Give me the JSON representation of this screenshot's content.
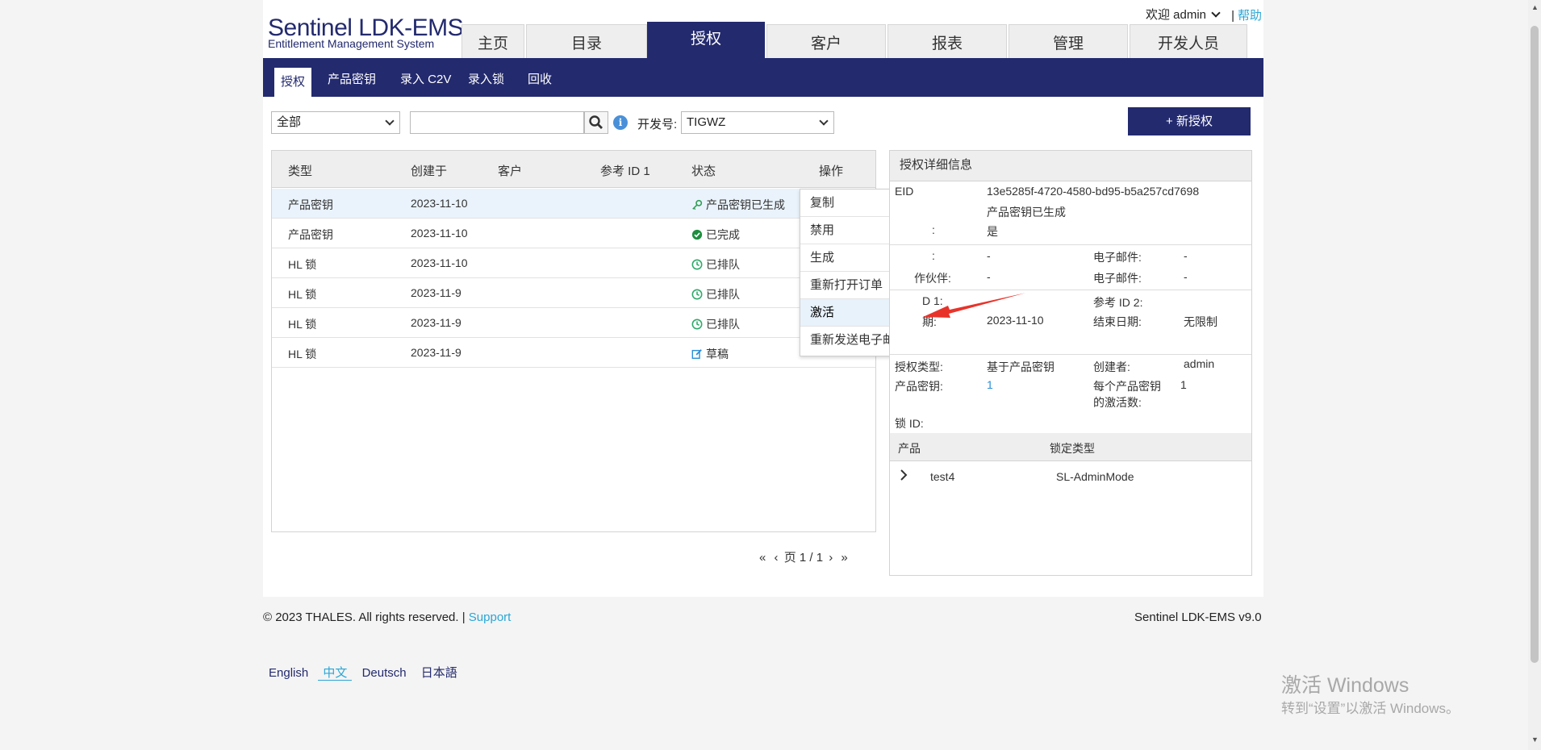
{
  "header": {
    "logo_title": "Sentinel LDK-EMS",
    "logo_subtitle": "Entitlement Management System",
    "welcome": "欢迎 admin",
    "help": "帮助",
    "tabs": [
      {
        "label": "主页"
      },
      {
        "label": "目录"
      },
      {
        "label": "授权"
      },
      {
        "label": "客户"
      },
      {
        "label": "报表"
      },
      {
        "label": "管理"
      },
      {
        "label": "开发人员"
      }
    ]
  },
  "subnav": {
    "items": [
      {
        "label": "授权"
      },
      {
        "label": "产品密钥"
      },
      {
        "label": "录入 C2V"
      },
      {
        "label": "录入锁"
      },
      {
        "label": "回收"
      }
    ]
  },
  "filters": {
    "type_value": "全部",
    "search_value": "",
    "batch_label": "开发号:",
    "batch_value": "TIGWZ",
    "new_button": "+ 新授权"
  },
  "table": {
    "headers": [
      "类型",
      "创建于",
      "客户",
      "参考 ID 1",
      "状态",
      "操作"
    ],
    "rows": [
      {
        "type": "产品密钥",
        "created": "2023-11-10",
        "status": "产品密钥已生成",
        "status_icon": "key-icon",
        "color": "#2e9e55"
      },
      {
        "type": "产品密钥",
        "created": "2023-11-10",
        "status": "已完成",
        "status_icon": "check-circle-icon",
        "color": "#1e8e3e"
      },
      {
        "type": "HL 锁",
        "created": "2023-11-10",
        "status": "已排队",
        "status_icon": "clock-icon",
        "color": "#2eaa6a"
      },
      {
        "type": "HL 锁",
        "created": "2023-11-9",
        "status": "已排队",
        "status_icon": "clock-icon",
        "color": "#2eaa6a"
      },
      {
        "type": "HL 锁",
        "created": "2023-11-9",
        "status": "已排队",
        "status_icon": "clock-icon",
        "color": "#2eaa6a"
      },
      {
        "type": "HL 锁",
        "created": "2023-11-9",
        "status": "草稿",
        "status_icon": "edit-icon",
        "color": "#2a8fd6"
      }
    ]
  },
  "context_menu": {
    "items": [
      {
        "label": "复制"
      },
      {
        "label": "禁用"
      },
      {
        "label": "生成"
      },
      {
        "label": "重新打开订单"
      },
      {
        "label": "激活"
      },
      {
        "label": "重新发送电子邮件"
      }
    ]
  },
  "pager": {
    "text": "页 1 / 1"
  },
  "detail": {
    "title": "授权详细信息",
    "eid_label": "EID",
    "eid": "13e5285f-4720-4580-bd95-b5a257cd7698",
    "status": "产品密钥已生成",
    "partial_label": ":",
    "yes": "是",
    "l1": ":",
    "v1": "-",
    "email_label": "电子邮件:",
    "email_value": "-",
    "partner_label": "作伙伴:",
    "partner_value": "-",
    "email2_label": "电子邮件:",
    "email2_value": "-",
    "ref1_label": "D 1:",
    "ref2_label": "参考 ID 2:",
    "start_label": "期:",
    "start_value": "2023-11-10",
    "end_label": "结束日期:",
    "end_value": "无限制",
    "ent_type_label": "授权类型:",
    "ent_type_value": "基于产品密钥",
    "creator_label": "创建者:",
    "creator_value": "admin",
    "pk_label": "产品密钥:",
    "pk_value": "1",
    "activations_label_1": "每个产品密钥",
    "activations_label_2": "的激活数:",
    "activations_value": "1",
    "lock_id_label": "锁 ID:",
    "product_header": "产品",
    "lock_type_header": "锁定类型",
    "product_name": "test4",
    "product_lock_type": "SL-AdminMode"
  },
  "footer": {
    "copyright": "© 2023 THALES. All rights reserved. |",
    "support": "Support",
    "version": "Sentinel LDK-EMS v9.0",
    "languages": [
      {
        "label": "English"
      },
      {
        "label": "中文"
      },
      {
        "label": "Deutsch"
      },
      {
        "label": "日本語"
      }
    ]
  },
  "watermark": {
    "line1": "激活 Windows",
    "line2": "转到“设置”以激活 Windows。"
  },
  "colors": {
    "brand": "#232a6e",
    "link": "#2aa6d6"
  }
}
